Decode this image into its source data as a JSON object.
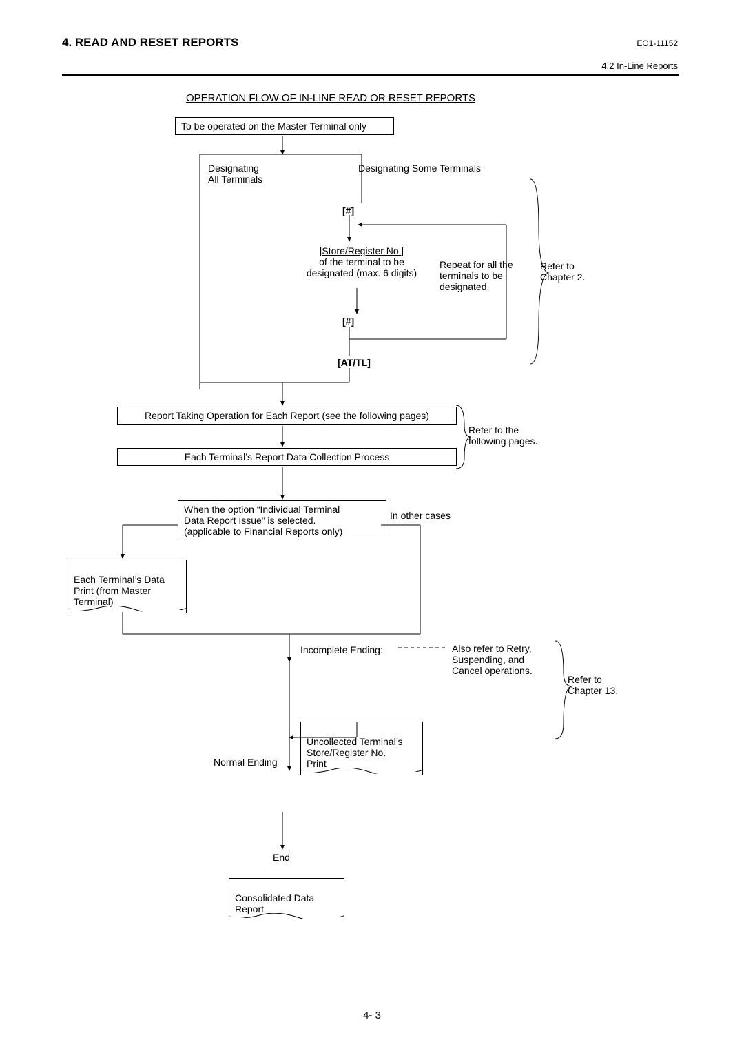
{
  "header": {
    "title": "4. READ AND RESET REPORTS",
    "doc_id": "EO1-11152",
    "sub": "4.2 In-Line Reports"
  },
  "flow": {
    "title": "OPERATION FLOW OF IN-LINE READ OR RESET REPORTS",
    "b_master": "To be operated on the Master Terminal only",
    "l_all": "Designating\nAll Terminals",
    "l_some": "Designating Some Terminals",
    "hash": "[#]",
    "store_reg_title": "|Store/Register No.|",
    "store_reg_desc": "of the terminal to be\ndesignated (max. 6 digits)",
    "repeat": "Repeat for all the\nterminals to be\ndesignated.",
    "ref_ch2": "Refer to\nChapter 2.",
    "attl": "[AT/TL]",
    "b_report_op": "Report Taking Operation for Each Report (see the following pages)",
    "b_collect": "Each Terminal’s Report Data Collection Process",
    "ref_following": "Refer to the\nfollowing pages.",
    "b_option": "When the option “Individual Terminal\nData Report Issue” is selected.\n(applicable to Financial Reports only)",
    "l_other": "In other cases",
    "w_each_print": "Each Terminal’s Data\nPrint (from Master\nTerminal)",
    "l_incomplete": "Incomplete Ending:",
    "w_uncollected": "Uncollected Terminal’s\nStore/Register No.\nPrint",
    "l_retry": "Also refer to Retry,\nSuspending, and\nCancel operations.",
    "ref_ch13": "Refer to\nChapter 13.",
    "l_normal": "Normal Ending",
    "w_consolidated": "Consolidated Data\nReport",
    "l_end": "End"
  },
  "page": "4- 3"
}
